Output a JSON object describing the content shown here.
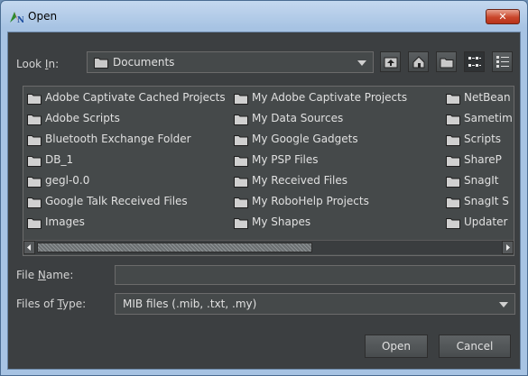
{
  "window": {
    "title": "Open",
    "close_label": "✕"
  },
  "look_in": {
    "label_pre": "Look ",
    "label_u": "I",
    "label_post": "n:",
    "value": "Documents"
  },
  "toolbar": {
    "icons": [
      "up-folder-icon",
      "home-icon",
      "new-folder-icon",
      "list-view-icon",
      "details-view-icon"
    ]
  },
  "files": {
    "col1": [
      "Adobe Captivate Cached Projects",
      "Adobe Scripts",
      "Bluetooth Exchange Folder",
      "DB_1",
      "gegl-0.0",
      "Google Talk Received Files",
      "Images"
    ],
    "col2": [
      "My Adobe Captivate Projects",
      "My Data Sources",
      "My Google Gadgets",
      "My PSP Files",
      "My Received Files",
      "My RoboHelp Projects",
      "My Shapes"
    ],
    "col3": [
      "NetBean",
      "Sametim",
      "Scripts",
      "ShareP",
      "SnagIt",
      "SnagIt S",
      "Updater"
    ]
  },
  "file_name": {
    "label_pre": "File ",
    "label_u": "N",
    "label_post": "ame:",
    "value": ""
  },
  "file_type": {
    "label_pre": "Files of ",
    "label_u": "T",
    "label_post": "ype:",
    "value": "MIB files (.mib, .txt, .my)"
  },
  "buttons": {
    "open": "Open",
    "cancel": "Cancel"
  },
  "colors": {
    "titlebar": "#a7c3e3",
    "panel": "#3c3f41",
    "field": "#45494a",
    "text": "#e0e0e0",
    "close": "#c9462b"
  }
}
